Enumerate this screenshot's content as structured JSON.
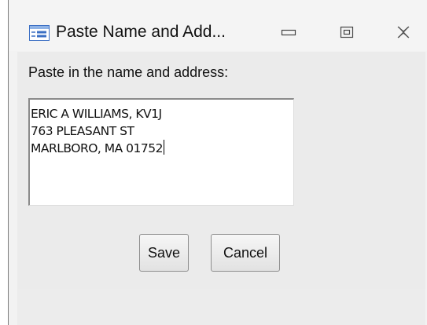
{
  "window": {
    "title": "Paste Name and Add...",
    "icons": {
      "app": "form-icon",
      "minimize": "minimize-icon",
      "restore": "restore-icon",
      "close": "close-icon"
    }
  },
  "form": {
    "prompt": "Paste in the name and address:",
    "address_lines": [
      "ERIC A WILLIAMS, KV1J",
      "763 PLEASANT ST",
      "MARLBORO, MA 01752"
    ]
  },
  "buttons": {
    "save": "Save",
    "cancel": "Cancel"
  },
  "colors": {
    "icon_accent": "#3b6fc4",
    "window_bg": "#f2f2f2",
    "content_bg": "#ebebeb"
  }
}
